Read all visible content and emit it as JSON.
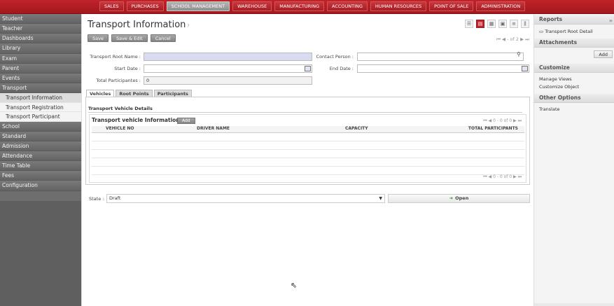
{
  "top_nav": [
    "SALES",
    "PURCHASES",
    "SCHOOL MANAGEMENT",
    "WAREHOUSE",
    "MANUFACTURING",
    "ACCOUNTING",
    "HUMAN RESOURCES",
    "POINT OF SALE",
    "ADMINISTRATION"
  ],
  "top_nav_active": "SCHOOL MANAGEMENT",
  "sidebar": {
    "menus_top": [
      "Student",
      "Teacher",
      "Dashboards",
      "Library",
      "Exam",
      "Parent",
      "Events",
      "Transport"
    ],
    "submenu": [
      "Transport Information",
      "Transport Registration",
      "Transport Participant"
    ],
    "submenu_selected": "Transport Information",
    "menus_bottom": [
      "School",
      "Standard",
      "Admission",
      "Attendance",
      "Time Table",
      "Fees",
      "Configuration"
    ]
  },
  "page": {
    "title": "Transport Information",
    "title_tip": "?",
    "buttons": {
      "save": "Save",
      "save_edit": "Save & Edit",
      "cancel": "Cancel"
    },
    "pager": "- of 2"
  },
  "form": {
    "root_name_label": "Transport Root Name :",
    "root_name_value": "",
    "contact_label": "Contact Person :",
    "contact_value": "",
    "start_date_label": "Start Date :",
    "start_date_value": "",
    "end_date_label": "End Date :",
    "end_date_value": "",
    "total_label": "Total Participantes :",
    "total_value": "0"
  },
  "tabs": [
    "Vehicles",
    "Root Points",
    "Participants"
  ],
  "vehicles": {
    "section_title": "Transport Vehicle Details",
    "grid_title": "Transport vehicle Information",
    "add_label": "Add",
    "pager": "0 - 0 of 0",
    "columns": [
      "VEHICLE NO",
      "DRIVER NAME",
      "CAPACITY",
      "TOTAL PARTICIPANTS"
    ]
  },
  "state": {
    "label": "State :",
    "value": "Draft",
    "open_label": "Open"
  },
  "right_sidebar": {
    "reports_title": "Reports",
    "reports_item": "Transport Root Detail",
    "attachments_title": "Attachments",
    "attachments_add": "Add",
    "customize_title": "Customize",
    "customize_items": [
      "Manage Views",
      "Customize Object"
    ],
    "other_title": "Other Options",
    "other_items": [
      "Translate"
    ]
  },
  "colors": {
    "topbar": "#b11e24",
    "sidebar": "#6e6e6e",
    "required_field": "#d8dbf2"
  }
}
